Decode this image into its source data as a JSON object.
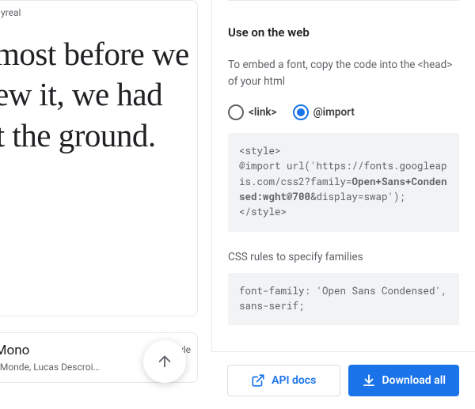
{
  "left": {
    "card1": {
      "meta": "yreal",
      "sample": "Almost before we knew it, we had left the ground."
    },
    "card2": {
      "title": "yne Mono",
      "author": "onjour Monde, Lucas Descroi…",
      "styles": "yle"
    }
  },
  "panel": {
    "title": "Use on the web",
    "description": "To embed a font, copy the code into the <head> of your html",
    "radio": {
      "link_label": "<link>",
      "import_label": "@import",
      "selected": "import"
    },
    "code": {
      "open": "<style>",
      "l1a": "@import url('https://fonts.googleapis.com/css2?family=",
      "l1b": "Open+Sans+Condensed:wght@700",
      "l1c": "&display=swap');",
      "close": "</style>"
    },
    "css_label": "CSS rules to specify families",
    "css_rule": "font-family: 'Open Sans Condensed', sans-serif;"
  },
  "actions": {
    "api_docs": "API docs",
    "download": "Download all"
  }
}
